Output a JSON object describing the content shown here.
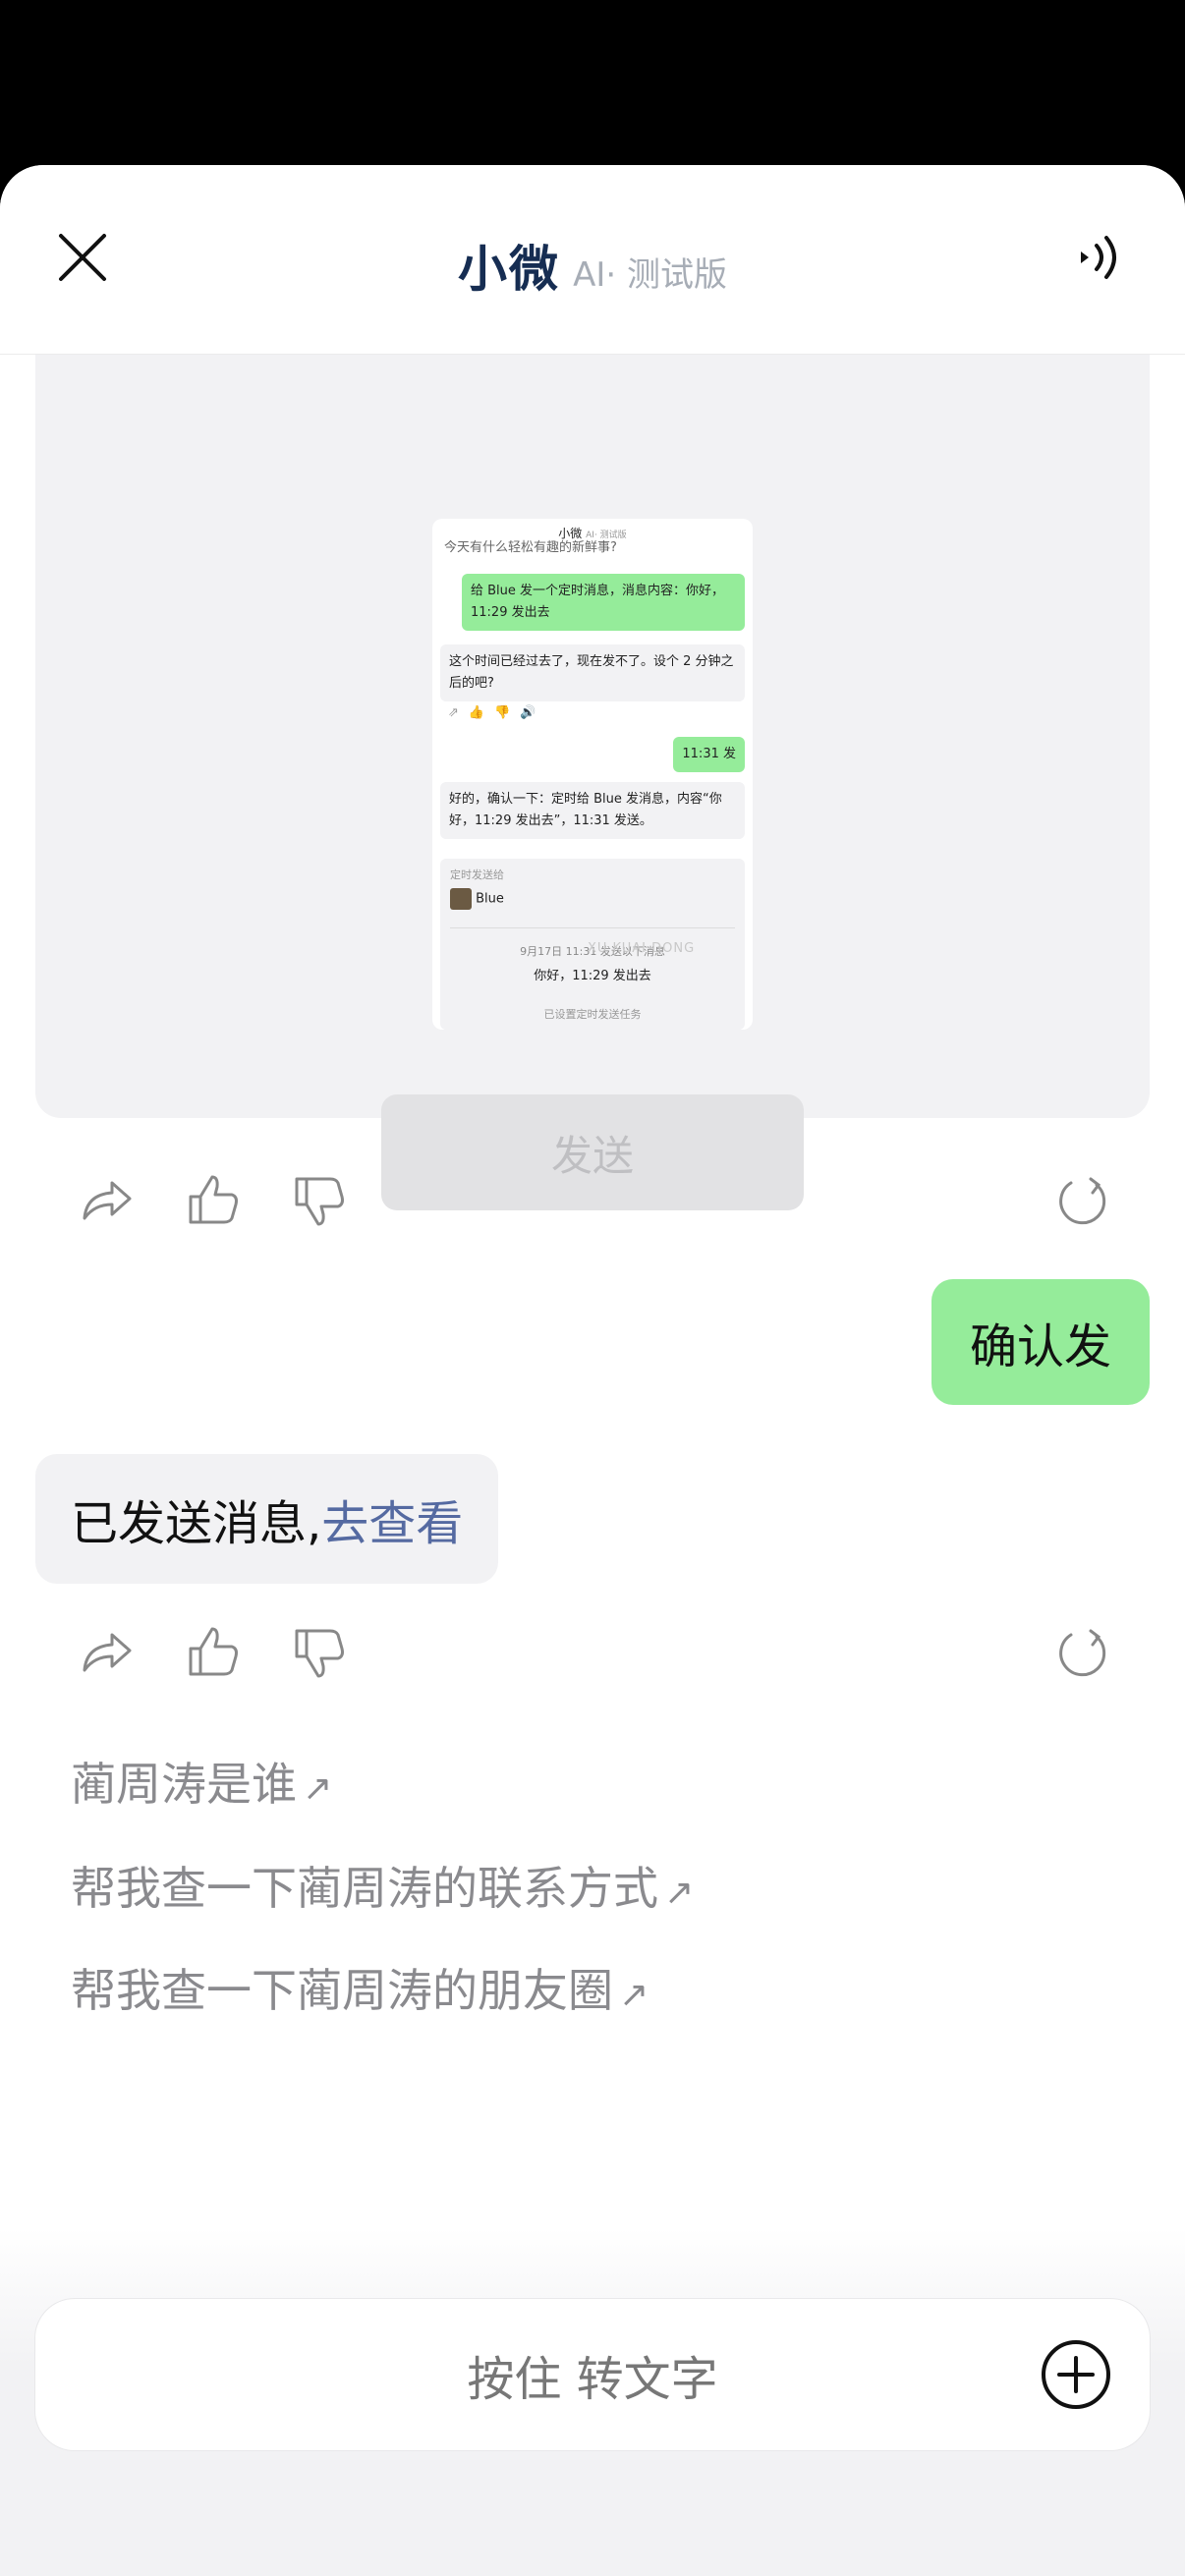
{
  "header": {
    "title": "小微",
    "subtitle": "AI· 测试版"
  },
  "embedded_screenshot": {
    "title": "小微",
    "subtitle": "AI· 测试版",
    "question": "今天有什么轻松有趣的新鲜事?",
    "msg1": "给 Blue 发一个定时消息，消息内容：你好，11:29 发出去",
    "msg2": "这个时间已经过去了，现在发不了。设个 2 分钟之后的吧?",
    "msg3": "11:31 发",
    "msg4": "好的，确认一下：定时给 Blue 发消息，内容“你好，11:29 发出去”，11:31 发送。",
    "sched_label": "定时发送给",
    "contact": "Blue",
    "sched_time": "9月17日 11:31 发送以下消息",
    "sched_content": "你好，11:29 发出去",
    "sched_status": "已设置定时发送任务",
    "watermark": "XU KUAI DONG"
  },
  "card": {
    "send_label": "发送"
  },
  "chat": {
    "user_message": "确认发",
    "bot_message": "已发送消息, ",
    "bot_link": "去查看"
  },
  "suggestions": [
    "蔺周涛是谁",
    "帮我查一下蔺周涛的联系方式",
    "帮我查一下蔺周涛的朋友圈"
  ],
  "input": {
    "hold_label": "按住 转文字"
  },
  "icons": {
    "close": "close-icon",
    "speaker": "speaker-icon",
    "share": "share-icon",
    "like": "thumbs-up-icon",
    "dislike": "thumbs-down-icon",
    "refresh": "refresh-icon",
    "plus": "plus-circle-icon",
    "suggestion_arrow": "arrow-up-right-icon"
  },
  "colors": {
    "user_bubble": "#95ec9a",
    "bot_bubble": "#f2f2f4",
    "link": "#556aa1",
    "title": "#162d52"
  }
}
